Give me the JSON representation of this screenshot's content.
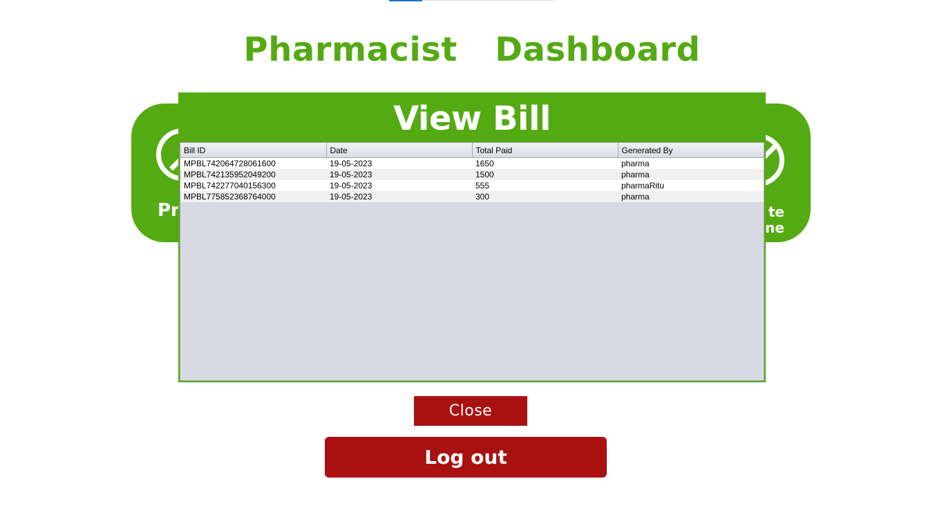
{
  "dashboard": {
    "title": "Pharmacist  Dashboard",
    "cards": [
      {
        "label": "Pr",
        "icon": "no-entry-icon"
      },
      {
        "label_lines": [
          "te",
          "ine"
        ],
        "icon": "pencil-circle-icon"
      }
    ],
    "logout_label": "Log out"
  },
  "modal": {
    "title": "View Bill",
    "close_label": "Close",
    "table": {
      "columns": [
        "Bill ID",
        "Date",
        "Total Paid",
        "Generated By"
      ],
      "rows": [
        [
          "MPBL742064728061600",
          "19-05-2023",
          "1650",
          "pharma"
        ],
        [
          "MPBL742135952049200",
          "19-05-2023",
          "1500",
          "pharma"
        ],
        [
          "MPBL742277040156300",
          "19-05-2023",
          "555",
          "pharmaRitu"
        ],
        [
          "MPBL775852368764000",
          "19-05-2023",
          "300",
          "pharma"
        ]
      ]
    }
  },
  "colors": {
    "brand_green": "#54aa13",
    "danger_red": "#a91111",
    "table_bg": "#d7dae2"
  }
}
